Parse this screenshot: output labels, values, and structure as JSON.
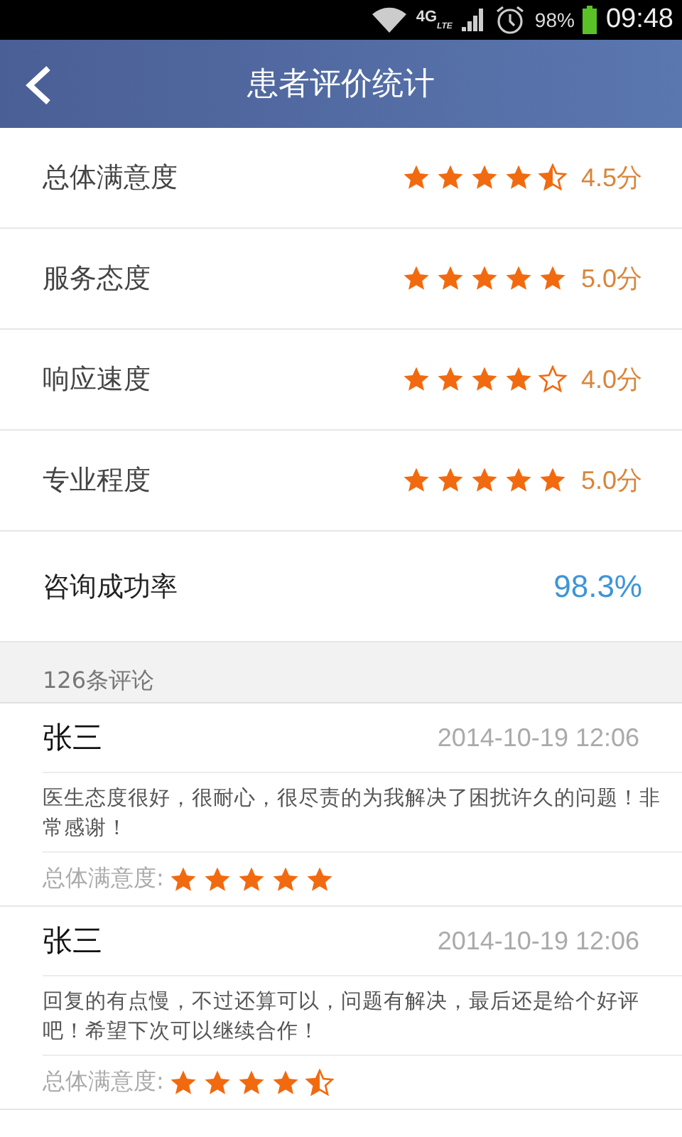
{
  "status_bar": {
    "network": "4G",
    "network_sub": "LTE",
    "battery": "98%",
    "time": "09:48"
  },
  "header": {
    "title": "患者评价统计"
  },
  "ratings": [
    {
      "label": "总体满意度",
      "stars": 4.5,
      "score": "4.5分"
    },
    {
      "label": "服务态度",
      "stars": 5,
      "score": "5.0分"
    },
    {
      "label": "响应速度",
      "stars": 4,
      "score": "4.0分"
    },
    {
      "label": "专业程度",
      "stars": 5,
      "score": "5.0分"
    }
  ],
  "success_rate": {
    "label": "咨询成功率",
    "value": "98.3%"
  },
  "reviews_header": "126条评论",
  "reviews": [
    {
      "name": "张三",
      "time": "2014-10-19 12:06",
      "comment": "医生态度很好，很耐心，很尽责的为我解决了困扰许久的问题！非常感谢！",
      "rating_label": "总体满意度:",
      "stars": 5
    },
    {
      "name": "张三",
      "time": "2014-10-19 12:06",
      "comment": "回复的有点慢，不过还算可以，问题有解决，最后还是给个好评吧！希望下次可以继续合作！",
      "rating_label": "总体满意度:",
      "stars": 4.5
    }
  ]
}
